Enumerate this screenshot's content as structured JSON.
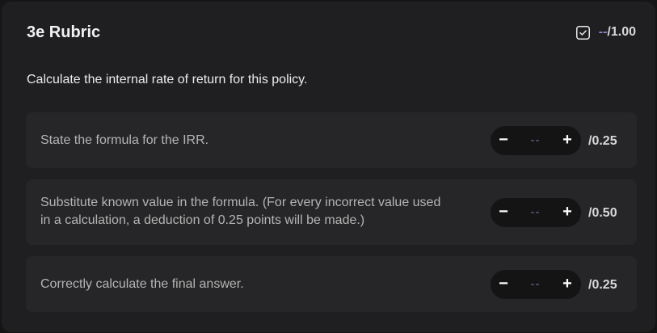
{
  "header": {
    "title": "3e Rubric",
    "score_value": "--",
    "score_max": "/1.00"
  },
  "question": "Calculate the internal rate of return for this policy.",
  "items": [
    {
      "label_line1": "State the formula for the IRR.",
      "label_line2": "",
      "minus": "−",
      "value": "--",
      "plus": "+",
      "max": "/0.25"
    },
    {
      "label_line1": "Substitute known value in the formula. (For every incorrect value used",
      "label_line2": "in a calculation, a deduction of 0.25 points will be made.)",
      "minus": "−",
      "value": "--",
      "plus": "+",
      "max": "/0.50"
    },
    {
      "label_line1": "Correctly calculate the final answer.",
      "label_line2": "",
      "minus": "−",
      "value": "--",
      "plus": "+",
      "max": "/0.25"
    }
  ],
  "icons": {
    "header_icon": "checkbox-icon"
  },
  "colors": {
    "background": "#151516",
    "card": "#1f1f21",
    "item_background": "#262628",
    "stepper_background": "#141415",
    "placeholder_accent": "#8b84c9"
  }
}
